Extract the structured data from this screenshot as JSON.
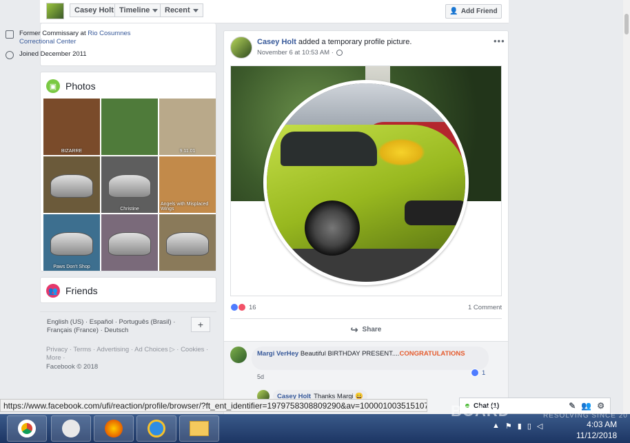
{
  "profile_bar": {
    "name": "Casey Holt",
    "timeline": "Timeline",
    "recent": "Recent",
    "add_friend": "Add Friend"
  },
  "intro": {
    "work_prefix": "Former Commissary at ",
    "work_place": "Rio Cosumnes Correctional Center",
    "joined": "Joined December 2011"
  },
  "photos": {
    "title": "Photos",
    "tiles": [
      {
        "caption": "BIZARRE",
        "color": "#7a4b2a"
      },
      {
        "caption": "",
        "color": "#4f7b3a"
      },
      {
        "caption": "9.11.01",
        "color": "#b9a98a"
      },
      {
        "caption": "",
        "color": "#6b5a3a"
      },
      {
        "caption": "Christine",
        "color": "#5e5e5e"
      },
      {
        "caption": "Angels with Misplaced Wings",
        "color": "#c28a4a"
      },
      {
        "caption": "Paws Don't Shop",
        "color": "#3d6f8f"
      },
      {
        "caption": "",
        "color": "#7a6a7a"
      },
      {
        "caption": "",
        "color": "#8a7a5a"
      }
    ]
  },
  "friends": {
    "title": "Friends"
  },
  "languages": {
    "text": "English (US) · Español · Português (Brasil) · Français (France) · Deutsch",
    "plus": "+"
  },
  "footer": {
    "links": "Privacy · Terms · Advertising · Ad Choices ▷ · Cookies · More ·",
    "copyright": "Facebook © 2018"
  },
  "post": {
    "author": "Casey Holt",
    "action": " added a temporary profile picture.",
    "time": "November 6 at 10:53 AM ·",
    "more": "•••",
    "reaction_count": "16",
    "comment_count": "1 Comment",
    "share": "Share"
  },
  "comments": [
    {
      "author": "Margi VerHey",
      "text": " Beautiful BIRTHDAY PRESENT....",
      "highlight": "CONGRATULATIONS",
      "likes": "1",
      "time": "5d"
    },
    {
      "author": "Casey Holt",
      "text": " Thanks Margi 😀"
    }
  ],
  "status_url": "https://www.facebook.com/ufi/reaction/profile/browser/?ft_ent_identifier=1979758308809290&av=100001003515107",
  "chat": {
    "label": "Chat (1)"
  },
  "taskbar": {
    "time": "4:03 AM",
    "date": "11/12/2018",
    "watermark": "BOARD",
    "watermark_sub": "RESOLVING SINCE 20"
  },
  "colors": {
    "facebook_blue": "#365899",
    "page_bg": "#e9ebee",
    "congrats": "#e55a2c"
  }
}
